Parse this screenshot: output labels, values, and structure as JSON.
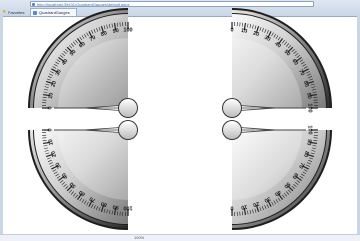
{
  "browser": {
    "address": "http://localhost:39431/QuadrantGauges/default.aspx",
    "favorites_label": "Favorites",
    "tab_title": "QuadrantGauges",
    "status_text": "100%"
  },
  "gauges": [
    {
      "id": "top-left",
      "quadrant": "top-left",
      "min": 0,
      "max": 100,
      "value": 0
    },
    {
      "id": "top-right",
      "quadrant": "top-right",
      "min": 0,
      "max": 100,
      "value": 100
    },
    {
      "id": "bottom-left",
      "quadrant": "bottom-left",
      "min": 0,
      "max": 100,
      "value": 0
    },
    {
      "id": "bottom-right",
      "quadrant": "bottom-right",
      "min": 0,
      "max": 100,
      "value": 100
    }
  ],
  "tick_labels": [
    "0",
    "10",
    "20",
    "30",
    "40",
    "50",
    "60",
    "70",
    "80",
    "90",
    "100"
  ],
  "colors": {
    "face_light": "#f2f2f2",
    "face_dark": "#7f7f7f",
    "rim": "#1e1e1e",
    "needle": "#ffffff",
    "text": "#202020"
  }
}
